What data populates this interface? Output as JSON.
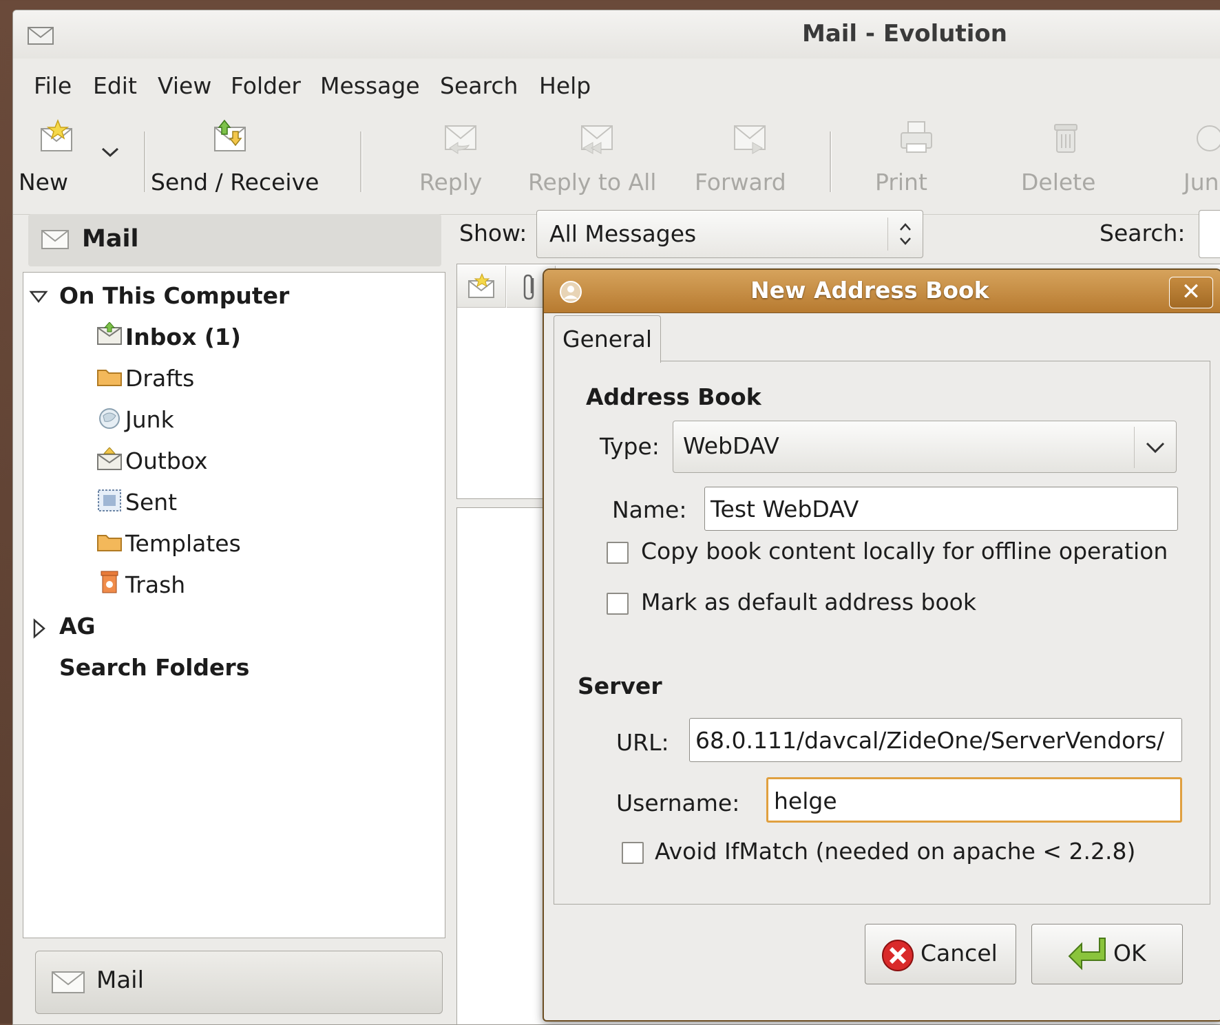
{
  "window": {
    "title": "Mail - Evolution"
  },
  "menu": {
    "file": "File",
    "edit": "Edit",
    "view": "View",
    "folder": "Folder",
    "message": "Message",
    "search": "Search",
    "help": "Help"
  },
  "toolbar": {
    "new": "New",
    "send_receive": "Send / Receive",
    "reply": "Reply",
    "reply_all": "Reply to All",
    "forward": "Forward",
    "print": "Print",
    "delete": "Delete",
    "junk": "Jun"
  },
  "sidebar": {
    "header": "Mail",
    "groups": [
      {
        "label": "On This Computer"
      },
      {
        "label": "AG"
      },
      {
        "label": "Search Folders"
      }
    ],
    "folders": [
      {
        "label": "Inbox (1)"
      },
      {
        "label": "Drafts"
      },
      {
        "label": "Junk"
      },
      {
        "label": "Outbox"
      },
      {
        "label": "Sent"
      },
      {
        "label": "Templates"
      },
      {
        "label": "Trash"
      }
    ],
    "switcher": "Mail"
  },
  "filter": {
    "show_label": "Show:",
    "show_value": "All Messages",
    "search_label": "Search:"
  },
  "dialog": {
    "title": "New Address Book",
    "tab": "General",
    "section_book": "Address Book",
    "type_label": "Type:",
    "type_value": "WebDAV",
    "name_label": "Name:",
    "name_value": "Test WebDAV",
    "copy_offline": "Copy book content locally for offline operation",
    "default_book": "Mark as default address book",
    "section_server": "Server",
    "url_label": "URL:",
    "url_value": "68.0.111/davcal/ZideOne/ServerVendors/",
    "username_label": "Username:",
    "username_value": "helge",
    "avoid_ifmatch": "Avoid IfMatch (needed on apache < 2.2.8)",
    "cancel": "Cancel",
    "ok": "OK"
  }
}
